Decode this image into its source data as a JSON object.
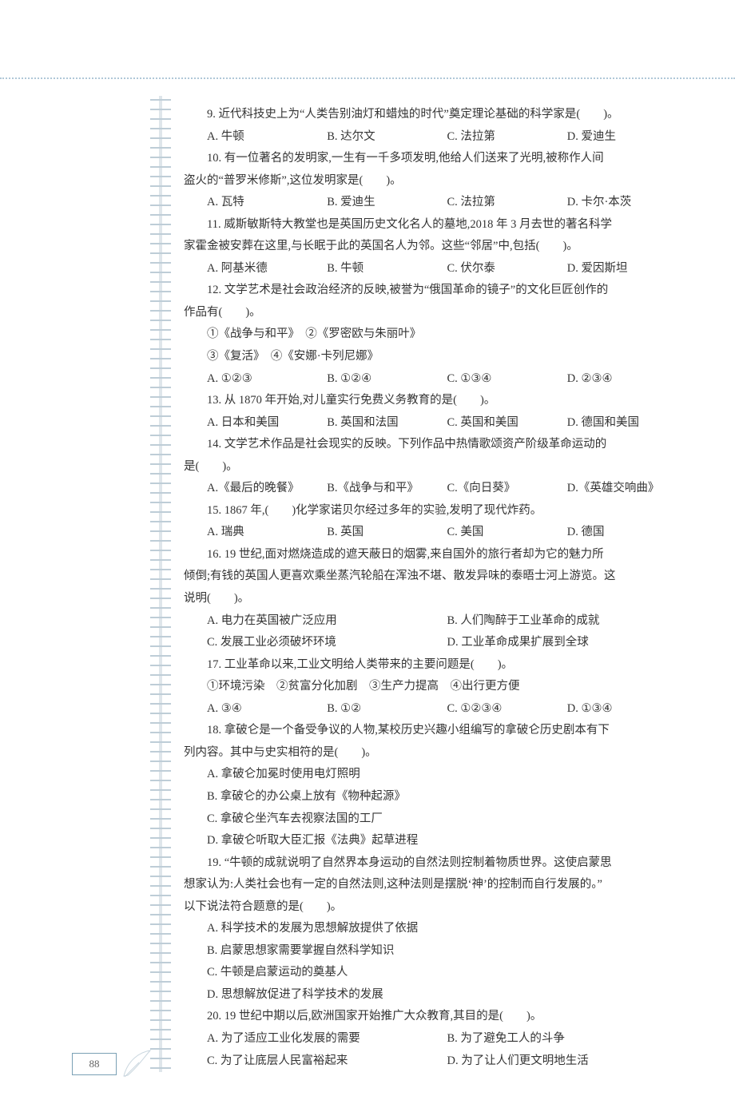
{
  "page_number": "88",
  "q9": {
    "stem": "9. 近代科技史上为“人类告别油灯和蜡烛的时代”奠定理论基础的科学家是(　　)。",
    "opts": [
      "A. 牛顿",
      "B. 达尔文",
      "C. 法拉第",
      "D. 爱迪生"
    ]
  },
  "q10": {
    "stem1": "10. 有一位著名的发明家,一生有一千多项发明,他给人们送来了光明,被称作人间",
    "stem2": "盗火的“普罗米修斯”,这位发明家是(　　)。",
    "opts": [
      "A. 瓦特",
      "B. 爱迪生",
      "C. 法拉第",
      "D. 卡尔·本茨"
    ]
  },
  "q11": {
    "stem1": "11. 威斯敏斯特大教堂也是英国历史文化名人的墓地,2018 年 3 月去世的著名科学",
    "stem2": "家霍金被安葬在这里,与长眠于此的英国名人为邻。这些“邻居”中,包括(　　)。",
    "opts": [
      "A. 阿基米德",
      "B. 牛顿",
      "C. 伏尔泰",
      "D. 爱因斯坦"
    ]
  },
  "q12": {
    "stem1": "12. 文学艺术是社会政治经济的反映,被誉为“俄国革命的镜子”的文化巨匠创作的",
    "stem2": "作品有(　　)。",
    "line1": "①《战争与和平》　②《罗密欧与朱丽叶》",
    "line2": "③《复活》　④《安娜·卡列尼娜》",
    "opts": [
      "A. ①②③",
      "B. ①②④",
      "C. ①③④",
      "D. ②③④"
    ]
  },
  "q13": {
    "stem": "13. 从 1870 年开始,对儿童实行免费义务教育的是(　　)。",
    "opts": [
      "A. 日本和美国",
      "B. 英国和法国",
      "C. 英国和美国",
      "D. 德国和美国"
    ]
  },
  "q14": {
    "stem1": "14. 文学艺术作品是社会现实的反映。下列作品中热情歌颂资产阶级革命运动的",
    "stem2": "是(　　)。",
    "opts": [
      "A.《最后的晚餐》",
      "B.《战争与和平》",
      "C.《向日葵》",
      "D.《英雄交响曲》"
    ]
  },
  "q15": {
    "stem": "15. 1867 年,(　　)化学家诺贝尔经过多年的实验,发明了现代炸药。",
    "opts": [
      "A. 瑞典",
      "B. 英国",
      "C. 美国",
      "D. 德国"
    ]
  },
  "q16": {
    "stem1": "16. 19 世纪,面对燃烧造成的遮天蔽日的烟雾,来自国外的旅行者却为它的魅力所",
    "stem2": "倾倒;有钱的英国人更喜欢乘坐蒸汽轮船在浑浊不堪、散发异味的泰晤士河上游览。这",
    "stem3": "说明(　　)。",
    "opts": [
      "A. 电力在英国被广泛应用",
      "B. 人们陶醉于工业革命的成就",
      "C. 发展工业必须破坏环境",
      "D. 工业革命成果扩展到全球"
    ]
  },
  "q17": {
    "stem": "17. 工业革命以来,工业文明给人类带来的主要问题是(　　)。",
    "line1": "①环境污染　②贫富分化加剧　③生产力提高　④出行更方便",
    "opts": [
      "A. ③④",
      "B. ①②",
      "C. ①②③④",
      "D. ①③④"
    ]
  },
  "q18": {
    "stem1": "18. 拿破仑是一个备受争议的人物,某校历史兴趣小组编写的拿破仑历史剧本有下",
    "stem2": "列内容。其中与史实相符的是(　　)。",
    "opts": [
      "A. 拿破仑加冕时使用电灯照明",
      "B. 拿破仑的办公桌上放有《物种起源》",
      "C. 拿破仑坐汽车去视察法国的工厂",
      "D. 拿破仑听取大臣汇报《法典》起草进程"
    ]
  },
  "q19": {
    "stem1": "19. “牛顿的成就说明了自然界本身运动的自然法则控制着物质世界。这使启蒙思",
    "stem2": "想家认为:人类社会也有一定的自然法则,这种法则是摆脱‘神’的控制而自行发展的。”",
    "stem3": "以下说法符合题意的是(　　)。",
    "opts": [
      "A. 科学技术的发展为思想解放提供了依据",
      "B. 启蒙思想家需要掌握自然科学知识",
      "C. 牛顿是启蒙运动的奠基人",
      "D. 思想解放促进了科学技术的发展"
    ]
  },
  "q20": {
    "stem": "20. 19 世纪中期以后,欧洲国家开始推广大众教育,其目的是(　　)。",
    "opts": [
      "A. 为了适应工业化发展的需要",
      "B. 为了避免工人的斗争",
      "C. 为了让底层人民富裕起来",
      "D. 为了让人们更文明地生活"
    ]
  }
}
